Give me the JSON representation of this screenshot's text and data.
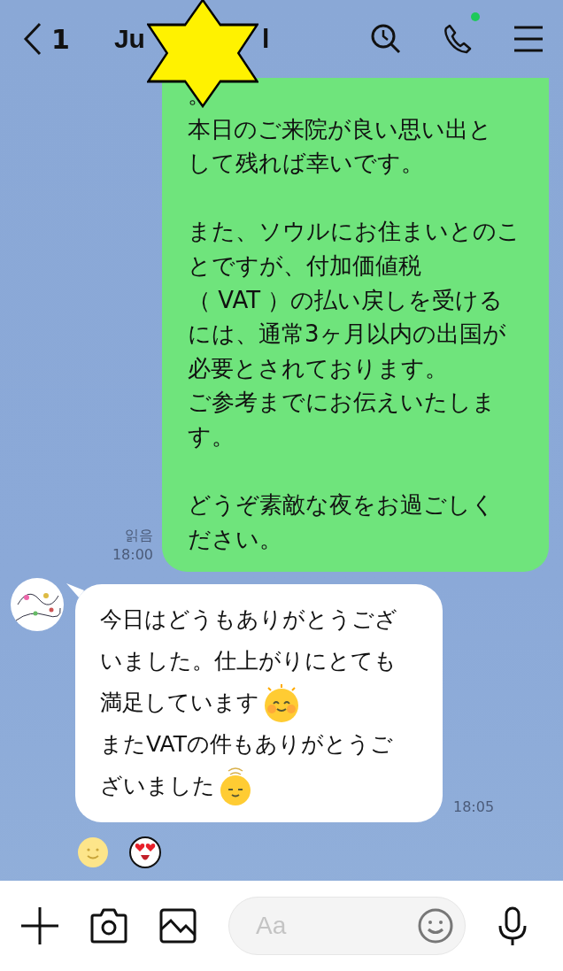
{
  "header": {
    "back_count": "1",
    "title_start": "Ju",
    "title_end": "l",
    "call_online": true
  },
  "messages": [
    {
      "kind": "outgoing",
      "paragraphs": [
        [
          "。",
          "本日のご来院が良い思い出と",
          "して残れば幸いです。"
        ],
        [
          "また、ソウルにお住まいとのこ",
          "とですが、付加価値税",
          "（ VAT ）の払い戻しを受ける",
          "には、通常3ヶ月以内の出国が",
          "必要とされております。",
          "ご参考までにお伝えいたしま",
          "す。"
        ],
        [
          "どうぞ素敵な夜をお過ごしく",
          "ださい。"
        ]
      ],
      "read_label": "읽음",
      "time": "18:00"
    },
    {
      "kind": "incoming",
      "lines": [
        {
          "text": "今日はどうもありがとうござ"
        },
        {
          "text": "いました。仕上がりにとても"
        },
        {
          "text": "満足しています",
          "sticker": {
            "kind": "beaming"
          }
        },
        {
          "text": "またVATの件もありがとうご"
        },
        {
          "text": "ざいました",
          "sticker": {
            "kind": "calm"
          }
        }
      ],
      "time": "18:05",
      "reactions": [
        {
          "kind": "smile"
        },
        {
          "kind": "hearteyes"
        }
      ]
    }
  ],
  "composer": {
    "placeholder": "Aa"
  }
}
